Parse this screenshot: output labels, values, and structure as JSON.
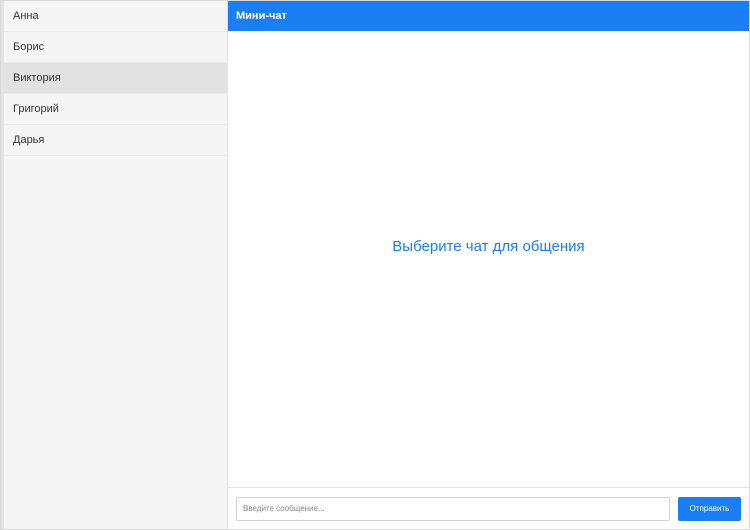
{
  "sidebar": {
    "contacts": [
      {
        "name": "Анна"
      },
      {
        "name": "Борис"
      },
      {
        "name": "Виктория"
      },
      {
        "name": "Григорий"
      },
      {
        "name": "Дарья"
      }
    ],
    "active_index": 2
  },
  "header": {
    "title": "Мини-чат"
  },
  "chat": {
    "placeholder": "Выберите чат для общения"
  },
  "composer": {
    "input_value": "",
    "input_placeholder": "Введите сообщение...",
    "send_label": "Отправить"
  },
  "colors": {
    "accent": "#1a7ff5",
    "sidebar_bg": "#f5f5f5",
    "active_item_bg": "#e2e2e2"
  }
}
